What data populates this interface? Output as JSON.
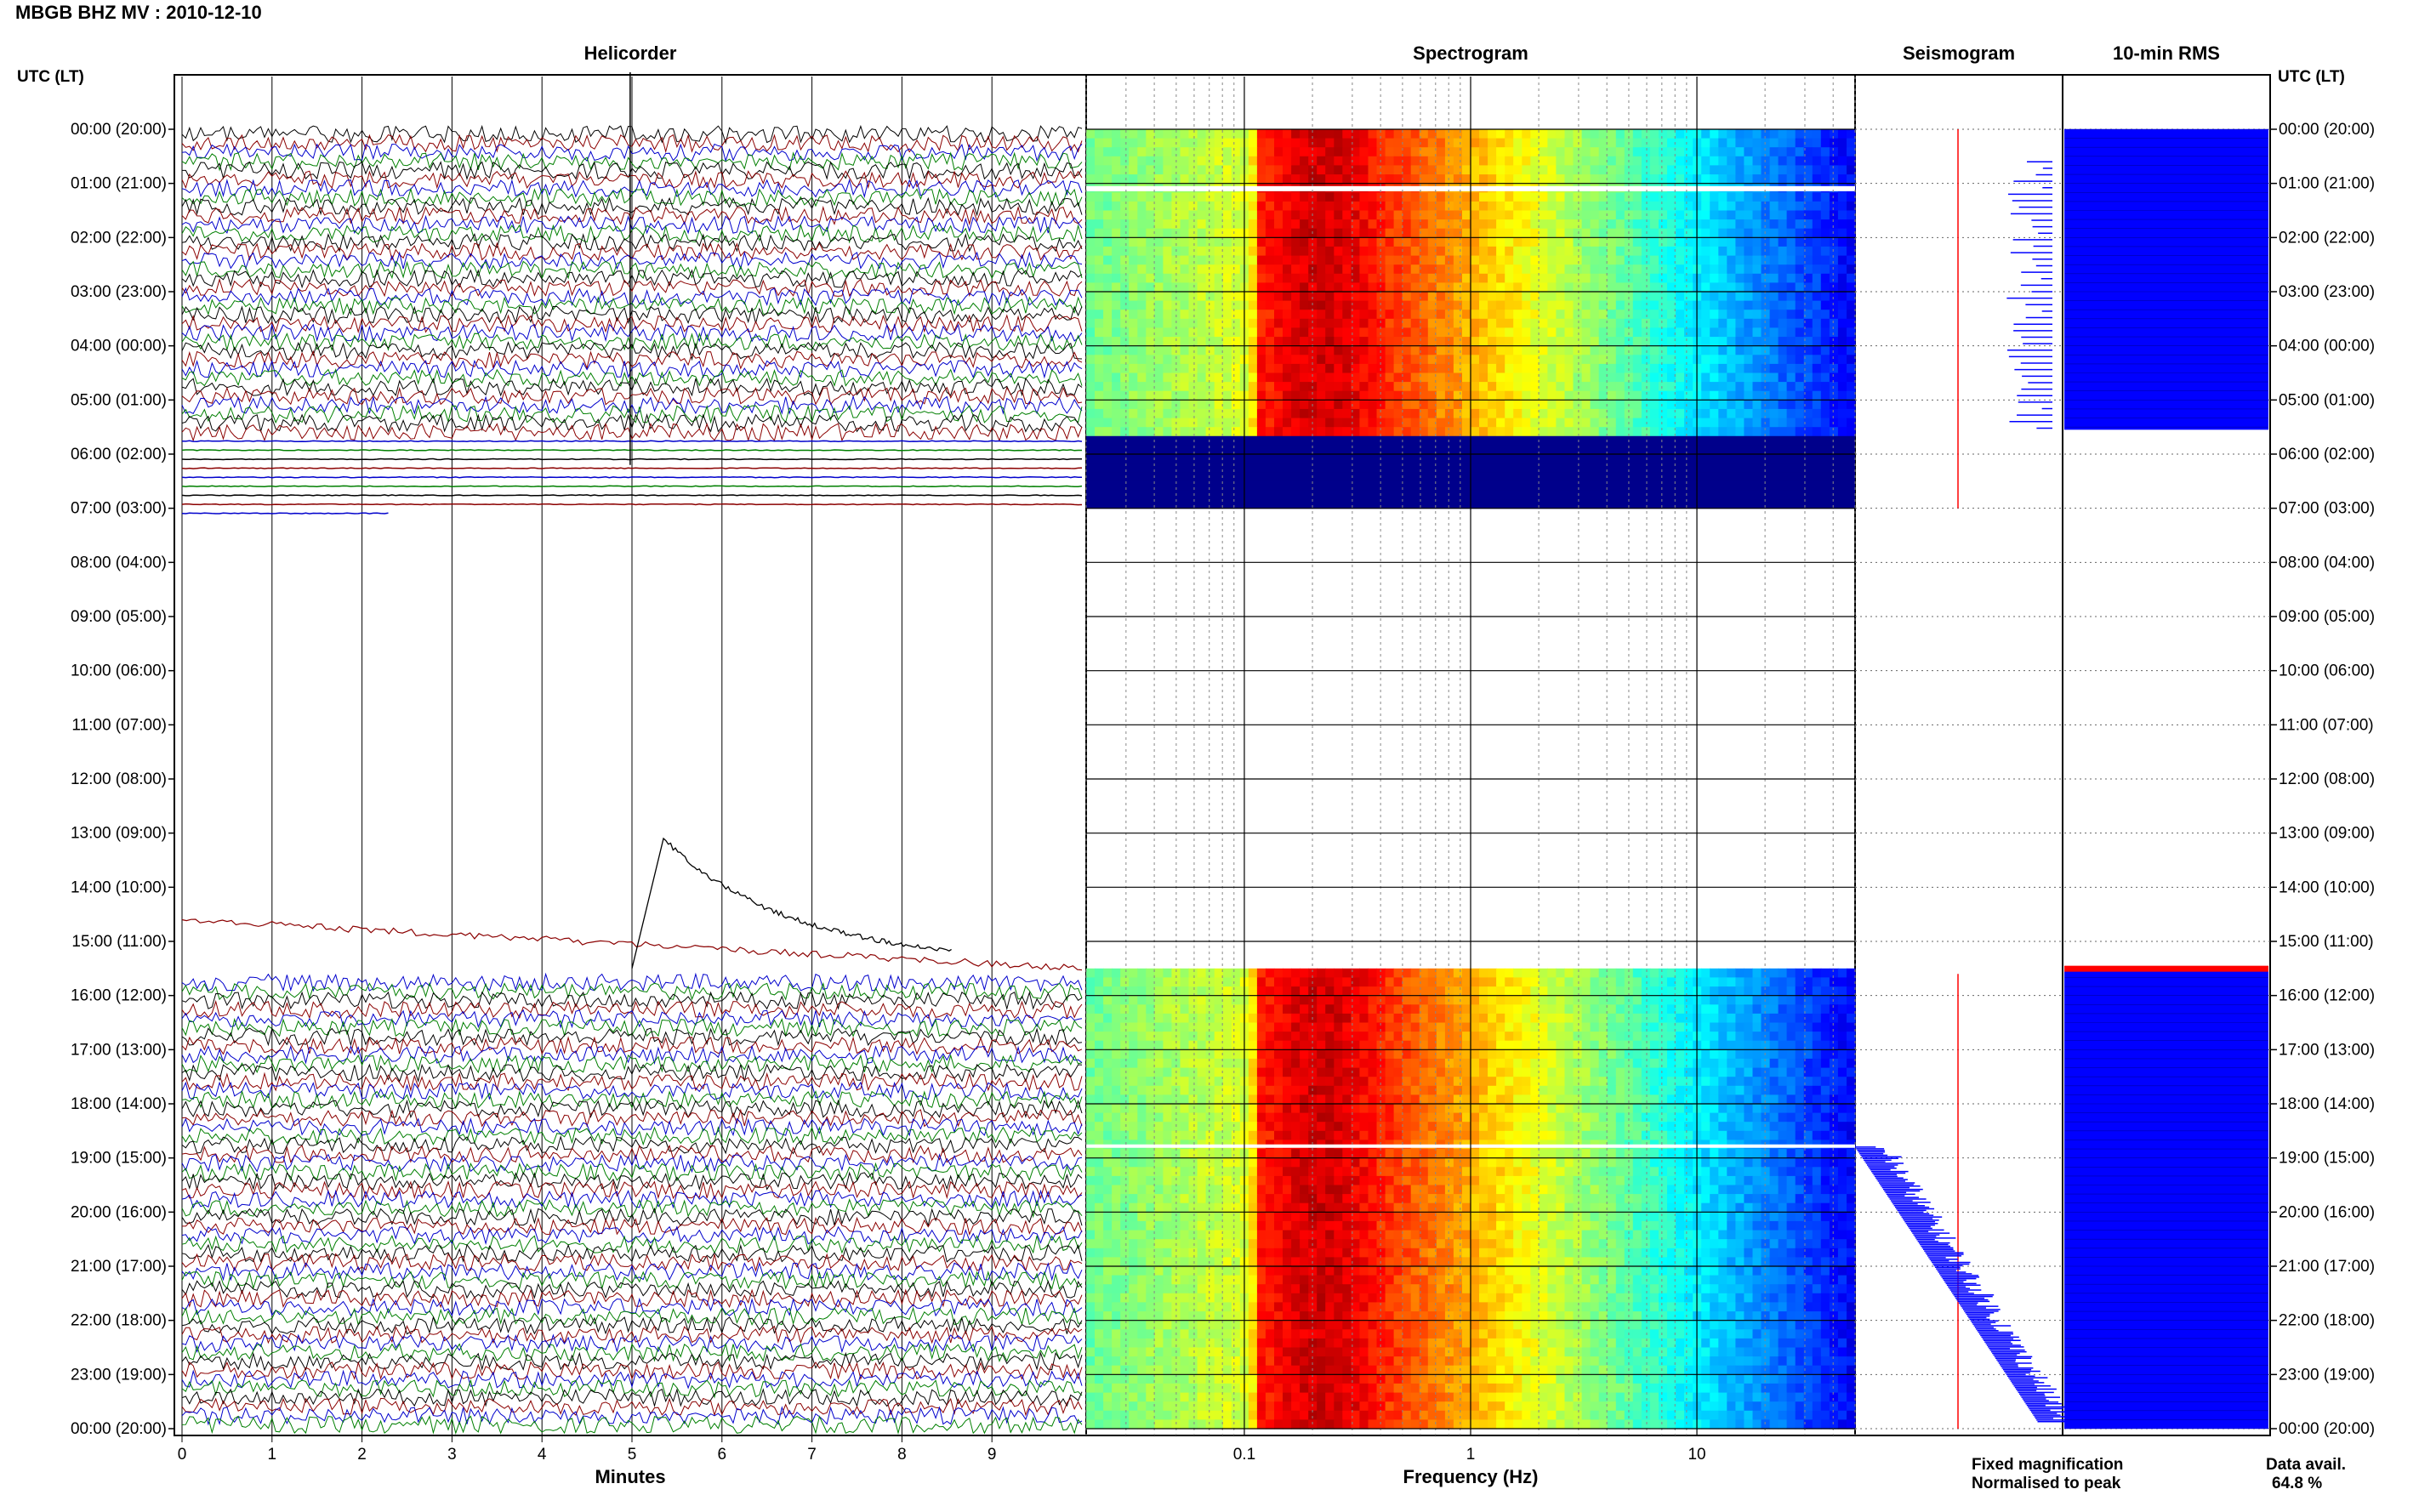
{
  "title": "MBGB BHZ MV : 2010-12-10",
  "panels": {
    "helicorder": "Helicorder",
    "spectrogram": "Spectrogram",
    "seismogram": "Seismogram",
    "rms": "10-min RMS"
  },
  "row_header_left": "UTC (LT)",
  "row_header_right": "UTC (LT)",
  "x_label_minutes": "Minutes",
  "x_label_frequency": "Frequency (Hz)",
  "legend": {
    "fixed": "Fixed magnification",
    "normalised": "Normalised to peak",
    "fixed_color": "#0000ff",
    "normalised_color": "#ff0000"
  },
  "data_avail_label": "Data avail.",
  "data_avail_value": "64.8 %",
  "colors": {
    "trace_cycle": [
      "#000000",
      "#8b0000",
      "#0000cc",
      "#007f00"
    ],
    "spectrogram_low": "#00008b",
    "spectrogram_high": "#cc1100",
    "seismogram_bar": "#0000ff",
    "rms_fill": "#0000ff",
    "marker_red": "#ff0000"
  },
  "chart_data": [
    {
      "type": "line",
      "panel": "helicorder",
      "xlabel": "Minutes",
      "x_ticks": [
        0,
        1,
        2,
        3,
        4,
        5,
        6,
        7,
        8,
        9
      ],
      "xlim": [
        0,
        10
      ],
      "time_labels": [
        "00:00 (20:00)",
        "01:00 (21:00)",
        "02:00 (22:00)",
        "03:00 (23:00)",
        "04:00 (00:00)",
        "05:00 (01:00)",
        "06:00 (02:00)",
        "07:00 (03:00)",
        "08:00 (04:00)",
        "09:00 (05:00)",
        "10:00 (06:00)",
        "11:00 (07:00)",
        "12:00 (08:00)",
        "13:00 (09:00)",
        "14:00 (10:00)",
        "15:00 (11:00)",
        "16:00 (12:00)",
        "17:00 (13:00)",
        "18:00 (14:00)",
        "19:00 (15:00)",
        "20:00 (16:00)",
        "21:00 (17:00)",
        "22:00 (18:00)",
        "23:00 (19:00)",
        "00:00 (20:00)"
      ],
      "data_gaps_utc_hours": [
        [
          7.1,
          15.6
        ]
      ]
    },
    {
      "type": "heatmap",
      "panel": "spectrogram",
      "xlabel": "Frequency (Hz)",
      "x_scale": "log",
      "x_ticks": [
        0.1,
        1,
        10
      ],
      "xlim": [
        0.02,
        50
      ],
      "peak_band_hz": [
        0.12,
        0.4
      ],
      "data_gaps_utc_hours": [
        [
          7.0,
          15.5
        ]
      ]
    },
    {
      "type": "bar",
      "panel": "seismogram",
      "series": [
        "Fixed magnification",
        "Normalised to peak"
      ]
    },
    {
      "type": "bar",
      "panel": "rms",
      "interval_minutes": 10
    }
  ]
}
